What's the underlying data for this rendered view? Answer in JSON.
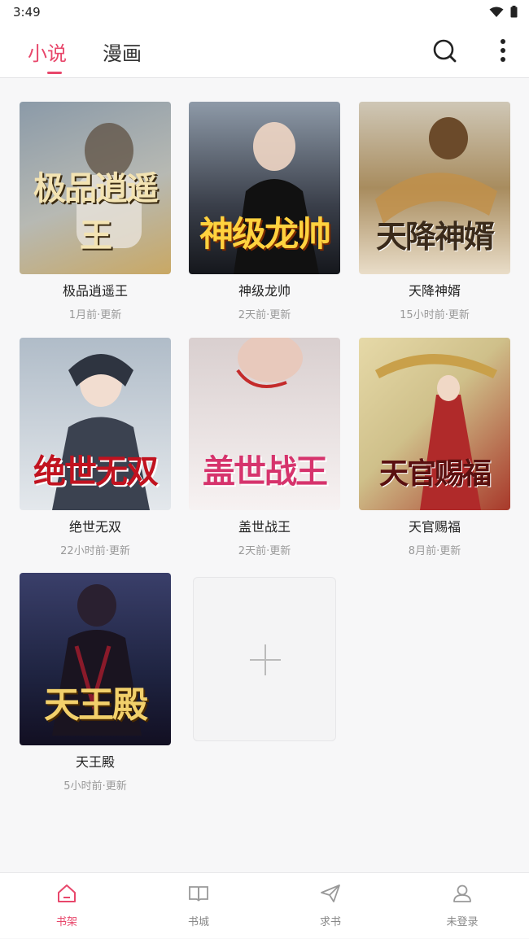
{
  "status": {
    "time": "3:49"
  },
  "tabs": [
    {
      "label": "小说",
      "active": true
    },
    {
      "label": "漫画",
      "active": false
    }
  ],
  "header_icons": [
    "search-icon",
    "more-vert-icon"
  ],
  "books": [
    {
      "title": "极品逍遥王",
      "updated": "1月前·更新",
      "cover_title": "极品逍遥王",
      "cover_colors": [
        "#8b9aa8",
        "#c9b48a"
      ]
    },
    {
      "title": "神级龙帅",
      "updated": "2天前·更新",
      "cover_title": "神级龙帅",
      "cover_colors": [
        "#2a2f3a",
        "#6a7180"
      ]
    },
    {
      "title": "天降神婿",
      "updated": "15小时前·更新",
      "cover_title": "天降神婿",
      "cover_colors": [
        "#b7a07a",
        "#e9ddc8"
      ]
    },
    {
      "title": "绝世无双",
      "updated": "22小时前·更新",
      "cover_title": "绝世无双",
      "cover_colors": [
        "#a9b3bf",
        "#e8ebef"
      ]
    },
    {
      "title": "盖世战王",
      "updated": "2天前·更新",
      "cover_title": "盖世战王",
      "cover_colors": [
        "#d9cfcf",
        "#f4eeee"
      ]
    },
    {
      "title": "天官赐福",
      "updated": "8月前·更新",
      "cover_title": "天官赐福",
      "cover_colors": [
        "#d7c79a",
        "#b23a2a"
      ]
    },
    {
      "title": "天王殿",
      "updated": "5小时前·更新",
      "cover_title": "天王殿",
      "cover_colors": [
        "#1e2340",
        "#4a3a6a"
      ]
    }
  ],
  "add_button": {
    "icon": "plus-icon"
  },
  "bottom_nav": [
    {
      "label": "书架",
      "icon": "home-icon",
      "active": true
    },
    {
      "label": "书城",
      "icon": "book-open-icon",
      "active": false
    },
    {
      "label": "求书",
      "icon": "send-icon",
      "active": false
    },
    {
      "label": "未登录",
      "icon": "user-icon",
      "active": false
    }
  ],
  "colors": {
    "accent": "#e8476b",
    "background": "#f7f7f8",
    "muted_text": "#999999"
  }
}
